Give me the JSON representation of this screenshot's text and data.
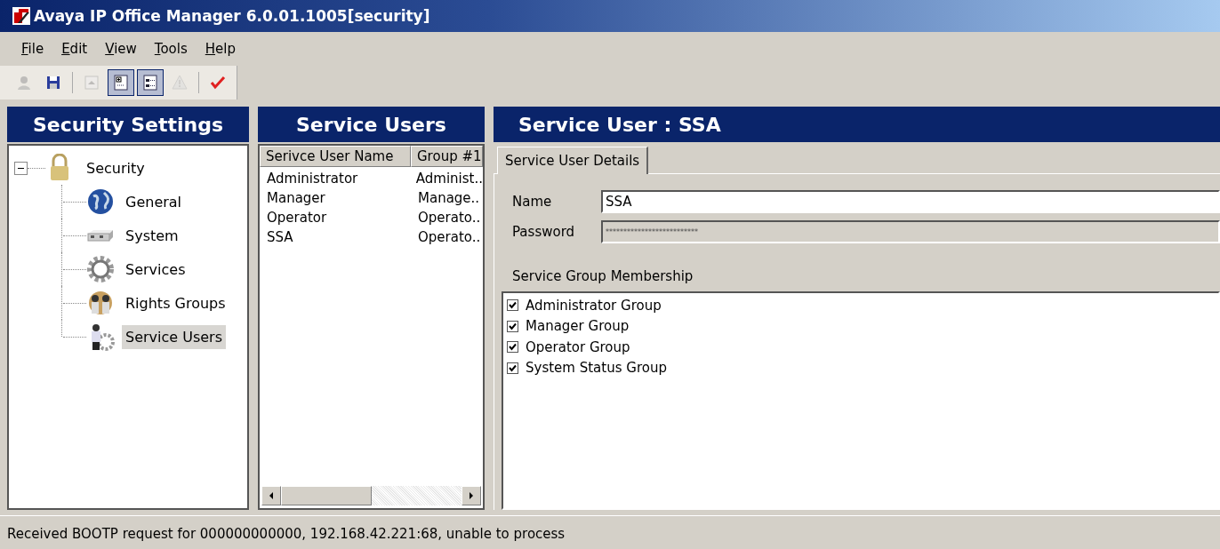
{
  "window": {
    "title": "Avaya IP Office Manager 6.0.01.1005[security]"
  },
  "menu": [
    {
      "label": "File"
    },
    {
      "label": "Edit"
    },
    {
      "label": "View"
    },
    {
      "label": "Tools"
    },
    {
      "label": "Help"
    }
  ],
  "toolbar": [
    {
      "kind": "person",
      "disabled": true,
      "pressed": false
    },
    {
      "kind": "save",
      "disabled": false,
      "pressed": false
    },
    {
      "kind": "separator"
    },
    {
      "kind": "up",
      "disabled": true,
      "pressed": false
    },
    {
      "kind": "pane1",
      "disabled": false,
      "pressed": true
    },
    {
      "kind": "pane2",
      "disabled": false,
      "pressed": true
    },
    {
      "kind": "warning",
      "disabled": true,
      "pressed": false
    },
    {
      "kind": "separator"
    },
    {
      "kind": "check",
      "disabled": false,
      "pressed": false
    }
  ],
  "left_panel": {
    "title": "Security Settings",
    "tree": [
      {
        "label": "Security",
        "expanded": true,
        "selected": false,
        "children": [
          {
            "label": "General",
            "selected": false
          },
          {
            "label": "System",
            "selected": false
          },
          {
            "label": "Services",
            "selected": false
          },
          {
            "label": "Rights Groups",
            "selected": false
          },
          {
            "label": "Service Users",
            "selected": true
          }
        ]
      }
    ]
  },
  "middle_panel": {
    "title": "Service Users",
    "columns": [
      "Serivce User Name",
      "Group #1"
    ],
    "rows": [
      {
        "cells": [
          "Administrator",
          "Administ.."
        ],
        "selected": false
      },
      {
        "cells": [
          "Manager",
          "Manage.."
        ],
        "selected": false
      },
      {
        "cells": [
          "Operator",
          "Operato.."
        ],
        "selected": false
      },
      {
        "cells": [
          "SSA",
          "Operato.."
        ],
        "selected": false
      }
    ]
  },
  "right_panel": {
    "title": "Service User :  SSA",
    "tabs": [
      {
        "label": "Service User Details",
        "selected": true
      }
    ],
    "fields": [
      {
        "label": "Name",
        "value": "SSA",
        "disabled": false
      },
      {
        "label": "Password",
        "value": "**************************",
        "disabled": true
      }
    ],
    "membership_label": "Service Group Membership",
    "groups": [
      {
        "label": "Administrator Group",
        "checked": true
      },
      {
        "label": "Manager Group",
        "checked": true
      },
      {
        "label": "Operator Group",
        "checked": true
      },
      {
        "label": "System Status Group",
        "checked": true
      }
    ]
  },
  "status_bar": "Received BOOTP request for 000000000000, 192.168.42.221:68, unable to process"
}
